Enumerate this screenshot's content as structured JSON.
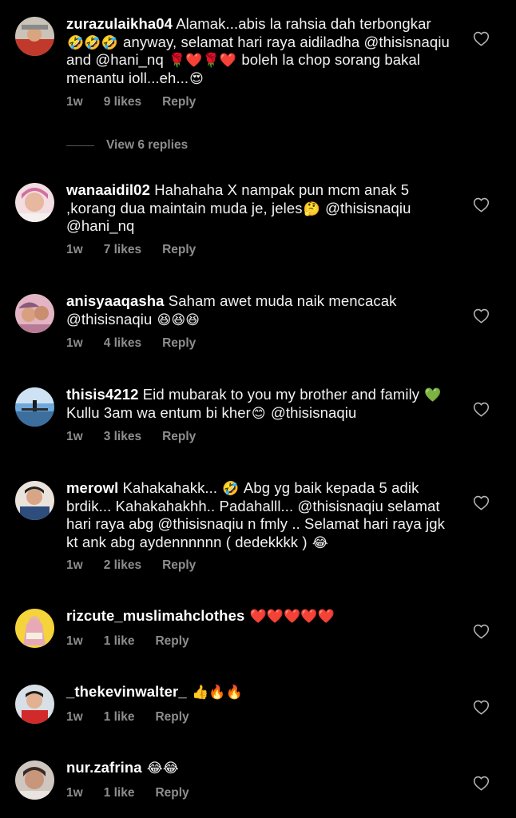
{
  "theme": {
    "background": "#000000",
    "muted": "#8e8e8e",
    "text": "#f2f2f2"
  },
  "comments": [
    {
      "username": "zurazulaikha04",
      "text_1": " Alamak...abis la rahsia dah terbongkar ",
      "emoji_1": "🤣🤣🤣",
      "text_2": " anyway, selamat hari raya aidiladha @thisisnaqiu and @hani_nq ",
      "emoji_2": "🌹❤️🌹❤️",
      "text_3": " boleh la chop sorang bakal menantu ioll...eh...",
      "emoji_3": "😍",
      "time": "1w",
      "likes": "9 likes",
      "reply": "Reply",
      "avatar_icon": "avatar-photo"
    },
    {
      "username": "wanaaidil02",
      "text_1": " Hahahaha X nampak pun mcm anak 5 ,korang dua maintain muda je, jeles",
      "emoji_1": "🤔",
      "text_2": " @thisisnaqiu @hani_nq",
      "time": "1w",
      "likes": "7 likes",
      "reply": "Reply",
      "avatar_icon": "avatar-photo"
    },
    {
      "username": "anisyaaqasha",
      "text_1": " Saham awet muda naik mencacak @thisisnaqiu ",
      "emoji_1": "😆😆😆",
      "time": "1w",
      "likes": "4 likes",
      "reply": "Reply",
      "avatar_icon": "avatar-photo"
    },
    {
      "username": "thisis4212",
      "text_1": " Eid mubarak to you my brother and family ",
      "emoji_1": "💚",
      "text_2": " Kullu 3am wa entum bi kher",
      "emoji_2": "😊",
      "text_3": " @thisisnaqiu",
      "time": "1w",
      "likes": "3 likes",
      "reply": "Reply",
      "avatar_icon": "avatar-photo"
    },
    {
      "username": "merowl",
      "text_1": " Kahakahakk... ",
      "emoji_1": "🤣",
      "text_2": " Abg yg baik kepada 5 adik brdik... Kahakahakhh.. Padahalll... @thisisnaqiu selamat hari raya abg @thisisnaqiu n fmly .. Selamat hari raya jgk kt ank abg aydennnnnn ( dedekkkk ) ",
      "emoji_2": "😂",
      "time": "1w",
      "likes": "2 likes",
      "reply": "Reply",
      "avatar_icon": "avatar-photo"
    },
    {
      "username": "rizcute_muslimahclothes",
      "text_1": " ",
      "emoji_1": "❤️❤️❤️❤️❤️",
      "time": "1w",
      "likes": "1 like",
      "reply": "Reply",
      "avatar_icon": "avatar-photo"
    },
    {
      "username": "_thekevinwalter_",
      "text_1": " ",
      "emoji_1": "👍🔥🔥",
      "time": "1w",
      "likes": "1 like",
      "reply": "Reply",
      "avatar_icon": "avatar-photo"
    },
    {
      "username": "nur.zafrina",
      "text_1": " ",
      "emoji_1": "😂😂",
      "time": "1w",
      "likes": "1 like",
      "reply": "Reply",
      "avatar_icon": "avatar-photo"
    }
  ],
  "view_replies": "View 6 replies",
  "icons": {
    "like": "heart-outline-icon"
  }
}
